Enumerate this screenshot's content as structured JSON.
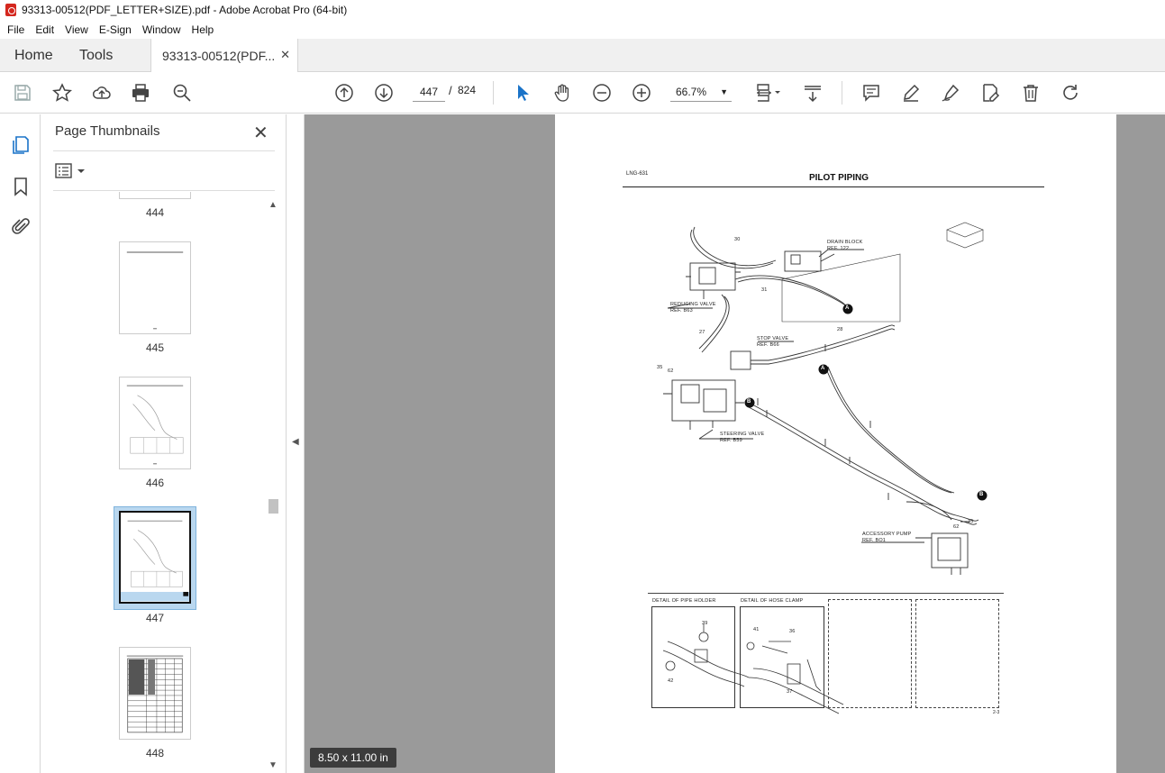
{
  "window": {
    "title": "93313-00512(PDF_LETTER+SIZE).pdf - Adobe Acrobat Pro (64-bit)"
  },
  "menu": [
    "File",
    "Edit",
    "View",
    "E-Sign",
    "Window",
    "Help"
  ],
  "tabs": {
    "home": "Home",
    "tools": "Tools",
    "doc": "93313-00512(PDF..."
  },
  "toolbar": {
    "current_page": "447",
    "page_sep": "/",
    "total_pages": "824",
    "zoom": "66.7%"
  },
  "icons": {
    "save": "save-icon",
    "bookmark_star": "star-icon",
    "upload": "upload-icon",
    "print": "print-icon",
    "zoom_search": "search-icon",
    "prev_page": "arrow-up-circle-icon",
    "next_page": "arrow-down-circle-icon",
    "select": "cursor-icon",
    "hand": "hand-icon",
    "zoom_out": "minus-circle-icon",
    "zoom_in": "plus-circle-icon",
    "fit": "fit-page-icon",
    "scroll_mode": "scroll-mode-icon",
    "comment": "comment-icon",
    "highlight": "highlight-icon",
    "sign": "sign-icon",
    "edit": "edit-pdf-icon",
    "delete": "trash-icon",
    "rotate": "rotate-icon"
  },
  "panel": {
    "title": "Page Thumbnails",
    "thumbnails": [
      {
        "label": "444"
      },
      {
        "label": "445"
      },
      {
        "label": "446"
      },
      {
        "label": "447"
      },
      {
        "label": "448"
      }
    ]
  },
  "document": {
    "page_size": "8.50 x 11.00 in",
    "doc_id": "LNG-631",
    "title": "PILOT PIPING",
    "labels": {
      "drain_block": "DRAIN BLOCK",
      "drain_ref": "REF. 122",
      "reducing_valve": "REDUCING VALVE",
      "reducing_ref": "REF. B63",
      "stop_valve": "STOP VALVE",
      "stop_ref": "REF. B66",
      "steering_valve": "STEERING VALVE",
      "steering_ref": "REF. B59",
      "accessory_pump": "ACCESSORY PUMP",
      "accessory_ref": "REF. BO1",
      "n30": "30",
      "n31": "31",
      "n27": "27",
      "n28": "28",
      "n35a": "35",
      "n62a": "62",
      "n35b": "35",
      "n62b": "62",
      "markA1": "A",
      "markA2": "A",
      "markB1": "B",
      "markB2": "B"
    },
    "details": {
      "pipe_holder": "DETAIL OF PIPE HOLDER",
      "hose_clamp": "DETAIL OF HOSE CLAMP",
      "n39": "39",
      "n42": "42",
      "n41": "41",
      "n36": "36",
      "n37": "37"
    },
    "page_number": "2-3"
  }
}
